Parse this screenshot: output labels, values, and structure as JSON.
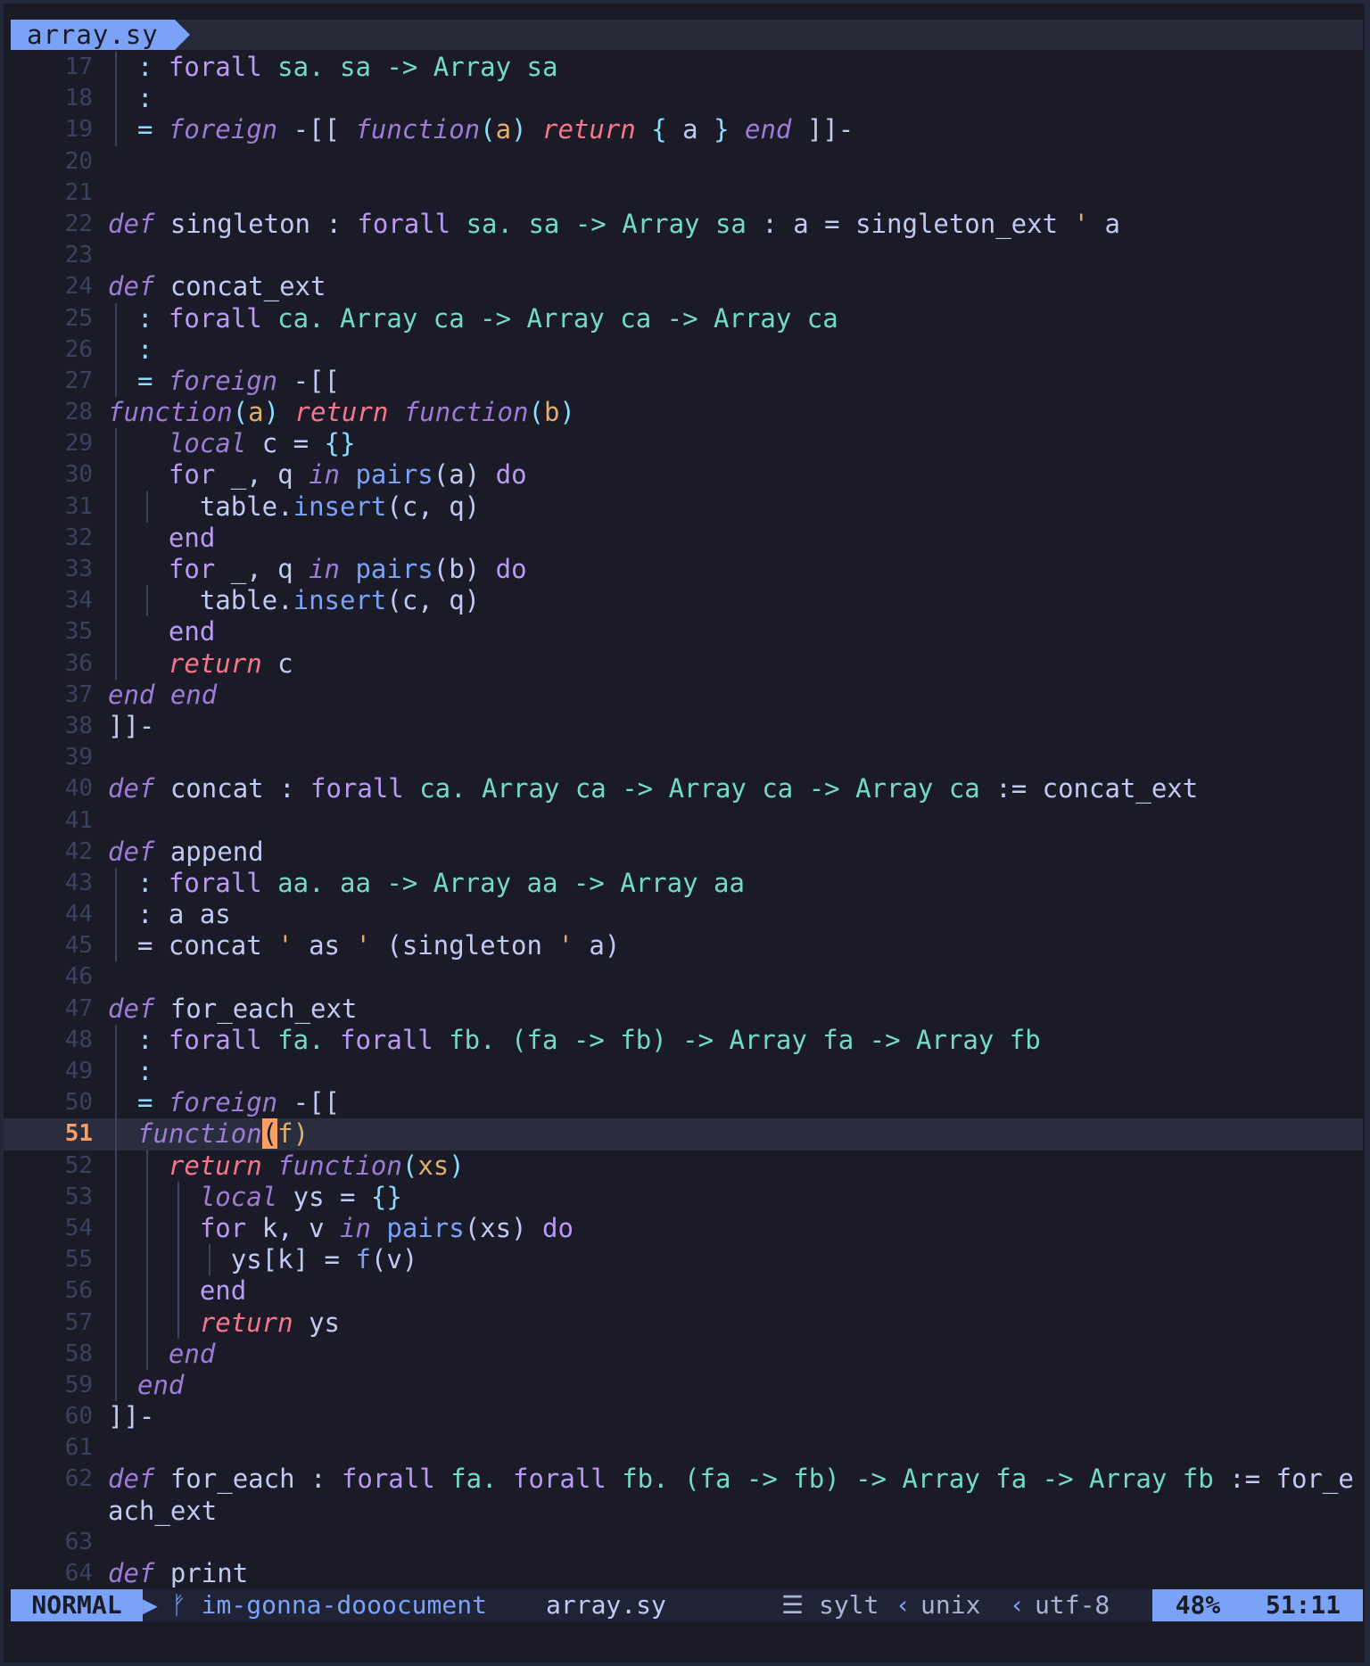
{
  "tab": {
    "filename": "array.sy"
  },
  "editor": {
    "cursor_line": 51,
    "lines": [
      {
        "num": "17",
        "guides": [
          1
        ],
        "toks": [
          {
            "t": ": ",
            "c": "pn"
          },
          {
            "t": "forall",
            "c": "kw2"
          },
          {
            "t": " sa. sa -> Array sa",
            "c": "ty"
          }
        ]
      },
      {
        "num": "18",
        "guides": [
          1
        ],
        "toks": [
          {
            "t": ":",
            "c": "pn"
          }
        ]
      },
      {
        "num": "19",
        "guides": [
          1
        ],
        "toks": [
          {
            "t": "= ",
            "c": "pn"
          },
          {
            "t": "foreign",
            "c": "kw"
          },
          {
            "t": " -[[ ",
            "c": ""
          },
          {
            "t": "function",
            "c": "kw"
          },
          {
            "t": "(",
            "c": "pn"
          },
          {
            "t": "a",
            "c": "pa"
          },
          {
            "t": ") ",
            "c": "pn"
          },
          {
            "t": "return",
            "c": "kw3"
          },
          {
            "t": " { ",
            "c": "pn"
          },
          {
            "t": "a",
            "c": ""
          },
          {
            "t": " } ",
            "c": "pn"
          },
          {
            "t": "end",
            "c": "kw"
          },
          {
            "t": " ]]-",
            "c": ""
          }
        ]
      },
      {
        "num": "20",
        "guides": [],
        "toks": []
      },
      {
        "num": "21",
        "guides": [],
        "toks": []
      },
      {
        "num": "22",
        "guides": [],
        "toks": [
          {
            "t": "def",
            "c": "kw"
          },
          {
            "t": " singleton : ",
            "c": ""
          },
          {
            "t": "forall",
            "c": "kw2"
          },
          {
            "t": " sa. sa -> Array sa",
            "c": "ty"
          },
          {
            "t": " : a = singleton_ext ",
            "c": ""
          },
          {
            "t": "'",
            "c": "pa"
          },
          {
            "t": " a",
            "c": ""
          }
        ]
      },
      {
        "num": "23",
        "guides": [],
        "toks": []
      },
      {
        "num": "24",
        "guides": [],
        "toks": [
          {
            "t": "def",
            "c": "kw"
          },
          {
            "t": " concat_ext",
            "c": ""
          }
        ]
      },
      {
        "num": "25",
        "guides": [
          1
        ],
        "toks": [
          {
            "t": ": ",
            "c": "pn"
          },
          {
            "t": "forall",
            "c": "kw2"
          },
          {
            "t": " ca. Array ca -> Array ca -> Array ca",
            "c": "ty"
          }
        ]
      },
      {
        "num": "26",
        "guides": [
          1
        ],
        "toks": [
          {
            "t": ":",
            "c": "pn"
          }
        ]
      },
      {
        "num": "27",
        "guides": [
          1
        ],
        "toks": [
          {
            "t": "= ",
            "c": "pn"
          },
          {
            "t": "foreign",
            "c": "kw"
          },
          {
            "t": " -[[",
            "c": ""
          }
        ]
      },
      {
        "num": "28",
        "guides": [],
        "toks": [
          {
            "t": "function",
            "c": "kw"
          },
          {
            "t": "(",
            "c": "pn"
          },
          {
            "t": "a",
            "c": "pa"
          },
          {
            "t": ") ",
            "c": "pn"
          },
          {
            "t": "return",
            "c": "kw3"
          },
          {
            "t": " ",
            "c": ""
          },
          {
            "t": "function",
            "c": "kw"
          },
          {
            "t": "(",
            "c": "pn"
          },
          {
            "t": "b",
            "c": "pa"
          },
          {
            "t": ")",
            "c": "pn"
          }
        ]
      },
      {
        "num": "29",
        "guides": [
          1
        ],
        "toks": [
          {
            "t": "  ",
            "c": ""
          },
          {
            "t": "local",
            "c": "kw"
          },
          {
            "t": " c = ",
            "c": ""
          },
          {
            "t": "{}",
            "c": "pn"
          }
        ]
      },
      {
        "num": "30",
        "guides": [
          1
        ],
        "toks": [
          {
            "t": "  ",
            "c": ""
          },
          {
            "t": "for",
            "c": "kw2"
          },
          {
            "t": " _, q ",
            "c": ""
          },
          {
            "t": "in",
            "c": "kw"
          },
          {
            "t": " ",
            "c": ""
          },
          {
            "t": "pairs",
            "c": "fn"
          },
          {
            "t": "(a) ",
            "c": ""
          },
          {
            "t": "do",
            "c": "kw2"
          }
        ]
      },
      {
        "num": "31",
        "guides": [
          1,
          2
        ],
        "toks": [
          {
            "t": "    table.",
            "c": ""
          },
          {
            "t": "insert",
            "c": "fn"
          },
          {
            "t": "(c, q)",
            "c": ""
          }
        ]
      },
      {
        "num": "32",
        "guides": [
          1
        ],
        "toks": [
          {
            "t": "  ",
            "c": ""
          },
          {
            "t": "end",
            "c": "kw2"
          }
        ]
      },
      {
        "num": "33",
        "guides": [
          1
        ],
        "toks": [
          {
            "t": "  ",
            "c": ""
          },
          {
            "t": "for",
            "c": "kw2"
          },
          {
            "t": " _, q ",
            "c": ""
          },
          {
            "t": "in",
            "c": "kw"
          },
          {
            "t": " ",
            "c": ""
          },
          {
            "t": "pairs",
            "c": "fn"
          },
          {
            "t": "(b) ",
            "c": ""
          },
          {
            "t": "do",
            "c": "kw2"
          }
        ]
      },
      {
        "num": "34",
        "guides": [
          1,
          2
        ],
        "toks": [
          {
            "t": "    table.",
            "c": ""
          },
          {
            "t": "insert",
            "c": "fn"
          },
          {
            "t": "(c, q)",
            "c": ""
          }
        ]
      },
      {
        "num": "35",
        "guides": [
          1
        ],
        "toks": [
          {
            "t": "  ",
            "c": ""
          },
          {
            "t": "end",
            "c": "kw2"
          }
        ]
      },
      {
        "num": "36",
        "guides": [
          1
        ],
        "toks": [
          {
            "t": "  ",
            "c": ""
          },
          {
            "t": "return",
            "c": "kw3"
          },
          {
            "t": " c",
            "c": ""
          }
        ]
      },
      {
        "num": "37",
        "guides": [],
        "toks": [
          {
            "t": "end end",
            "c": "kw"
          }
        ]
      },
      {
        "num": "38",
        "guides": [],
        "toks": [
          {
            "t": "]]-",
            "c": ""
          }
        ]
      },
      {
        "num": "39",
        "guides": [],
        "toks": []
      },
      {
        "num": "40",
        "guides": [],
        "toks": [
          {
            "t": "def",
            "c": "kw"
          },
          {
            "t": " concat : ",
            "c": ""
          },
          {
            "t": "forall",
            "c": "kw2"
          },
          {
            "t": " ca. Array ca -> Array ca -> Array ca",
            "c": "ty"
          },
          {
            "t": " := concat_ext",
            "c": ""
          }
        ]
      },
      {
        "num": "41",
        "guides": [],
        "toks": []
      },
      {
        "num": "42",
        "guides": [],
        "toks": [
          {
            "t": "def",
            "c": "kw"
          },
          {
            "t": " append",
            "c": ""
          }
        ]
      },
      {
        "num": "43",
        "guides": [
          1
        ],
        "toks": [
          {
            "t": ": ",
            "c": "pn"
          },
          {
            "t": "forall",
            "c": "kw2"
          },
          {
            "t": " aa. aa -> Array aa -> Array aa",
            "c": "ty"
          }
        ]
      },
      {
        "num": "44",
        "guides": [
          1
        ],
        "toks": [
          {
            "t": ": a as",
            "c": ""
          }
        ]
      },
      {
        "num": "45",
        "guides": [
          1
        ],
        "toks": [
          {
            "t": "= concat ",
            "c": ""
          },
          {
            "t": "'",
            "c": "pa"
          },
          {
            "t": " as ",
            "c": ""
          },
          {
            "t": "'",
            "c": "pa"
          },
          {
            "t": " (singleton ",
            "c": ""
          },
          {
            "t": "'",
            "c": "pa"
          },
          {
            "t": " a)",
            "c": ""
          }
        ]
      },
      {
        "num": "46",
        "guides": [],
        "toks": []
      },
      {
        "num": "47",
        "guides": [],
        "toks": [
          {
            "t": "def",
            "c": "kw"
          },
          {
            "t": " for_each_ext",
            "c": ""
          }
        ]
      },
      {
        "num": "48",
        "guides": [
          1
        ],
        "toks": [
          {
            "t": ": ",
            "c": "pn"
          },
          {
            "t": "forall",
            "c": "kw2"
          },
          {
            "t": " fa. ",
            "c": "ty"
          },
          {
            "t": "forall",
            "c": "kw2"
          },
          {
            "t": " fb. (fa -> fb) -> Array fa -> Array fb",
            "c": "ty"
          }
        ]
      },
      {
        "num": "49",
        "guides": [
          1
        ],
        "toks": [
          {
            "t": ":",
            "c": "pn"
          }
        ]
      },
      {
        "num": "50",
        "guides": [
          1
        ],
        "toks": [
          {
            "t": "= ",
            "c": "pn"
          },
          {
            "t": "foreign",
            "c": "kw"
          },
          {
            "t": " -[[",
            "c": ""
          }
        ]
      },
      {
        "num": "51",
        "guides": [
          1
        ],
        "toks": [
          {
            "t": "function",
            "c": "kw"
          },
          {
            "t": "(",
            "c": "cursor"
          },
          {
            "t": "f",
            "c": "pa"
          },
          {
            "t": ")",
            "c": "pa"
          }
        ]
      },
      {
        "num": "52",
        "guides": [
          1,
          2
        ],
        "toks": [
          {
            "t": "  ",
            "c": ""
          },
          {
            "t": "return",
            "c": "kw3"
          },
          {
            "t": " ",
            "c": ""
          },
          {
            "t": "function",
            "c": "kw"
          },
          {
            "t": "(",
            "c": "pn"
          },
          {
            "t": "xs",
            "c": "pa"
          },
          {
            "t": ")",
            "c": "pn"
          }
        ]
      },
      {
        "num": "53",
        "guides": [
          1,
          2,
          3
        ],
        "toks": [
          {
            "t": "    ",
            "c": ""
          },
          {
            "t": "local",
            "c": "kw"
          },
          {
            "t": " ys = ",
            "c": ""
          },
          {
            "t": "{}",
            "c": "pn"
          }
        ]
      },
      {
        "num": "54",
        "guides": [
          1,
          2,
          3
        ],
        "toks": [
          {
            "t": "    ",
            "c": ""
          },
          {
            "t": "for",
            "c": "kw2"
          },
          {
            "t": " k, v ",
            "c": ""
          },
          {
            "t": "in",
            "c": "kw"
          },
          {
            "t": " ",
            "c": ""
          },
          {
            "t": "pairs",
            "c": "fn"
          },
          {
            "t": "(xs) ",
            "c": ""
          },
          {
            "t": "do",
            "c": "kw2"
          }
        ]
      },
      {
        "num": "55",
        "guides": [
          1,
          2,
          3,
          4
        ],
        "toks": [
          {
            "t": "      ys[k] = ",
            "c": ""
          },
          {
            "t": "f",
            "c": "fn"
          },
          {
            "t": "(v)",
            "c": ""
          }
        ]
      },
      {
        "num": "56",
        "guides": [
          1,
          2,
          3
        ],
        "toks": [
          {
            "t": "    ",
            "c": ""
          },
          {
            "t": "end",
            "c": "kw2"
          }
        ]
      },
      {
        "num": "57",
        "guides": [
          1,
          2,
          3
        ],
        "toks": [
          {
            "t": "    ",
            "c": ""
          },
          {
            "t": "return",
            "c": "kw3"
          },
          {
            "t": " ys",
            "c": ""
          }
        ]
      },
      {
        "num": "58",
        "guides": [
          1,
          2
        ],
        "toks": [
          {
            "t": "  ",
            "c": ""
          },
          {
            "t": "end",
            "c": "kw"
          }
        ]
      },
      {
        "num": "59",
        "guides": [
          1
        ],
        "toks": [
          {
            "t": "end",
            "c": "kw"
          }
        ]
      },
      {
        "num": "60",
        "guides": [],
        "toks": [
          {
            "t": "]]-",
            "c": ""
          }
        ]
      },
      {
        "num": "61",
        "guides": [],
        "toks": []
      },
      {
        "num": "62",
        "guides": [],
        "toks": [
          {
            "t": "def",
            "c": "kw"
          },
          {
            "t": " for_each : ",
            "c": ""
          },
          {
            "t": "forall",
            "c": "kw2"
          },
          {
            "t": " fa. ",
            "c": "ty"
          },
          {
            "t": "forall",
            "c": "kw2"
          },
          {
            "t": " fb. (fa -> fb) -> Array fa -> Array fb",
            "c": "ty"
          },
          {
            "t": " := for_e",
            "c": ""
          }
        ]
      },
      {
        "num": "",
        "guides": [],
        "toks": [
          {
            "t": "ach_ext",
            "c": ""
          }
        ]
      },
      {
        "num": "63",
        "guides": [],
        "toks": []
      },
      {
        "num": "64",
        "guides": [],
        "toks": [
          {
            "t": "def",
            "c": "kw"
          },
          {
            "t": " print",
            "c": ""
          }
        ]
      }
    ]
  },
  "statusline": {
    "mode": "NORMAL",
    "branch_icon": "git-branch-icon",
    "branch": "im-gonna-dooocument",
    "filename": "array.sy",
    "filetype_icon": "menu-lines-icon",
    "filetype": "sylt",
    "fileformat": "unix",
    "encoding": "utf-8",
    "percent": "48%",
    "position": "51:11"
  },
  "colors": {
    "background": "#1a1b26",
    "accent": "#7aa2f7",
    "cursor": "#ff9e64"
  }
}
